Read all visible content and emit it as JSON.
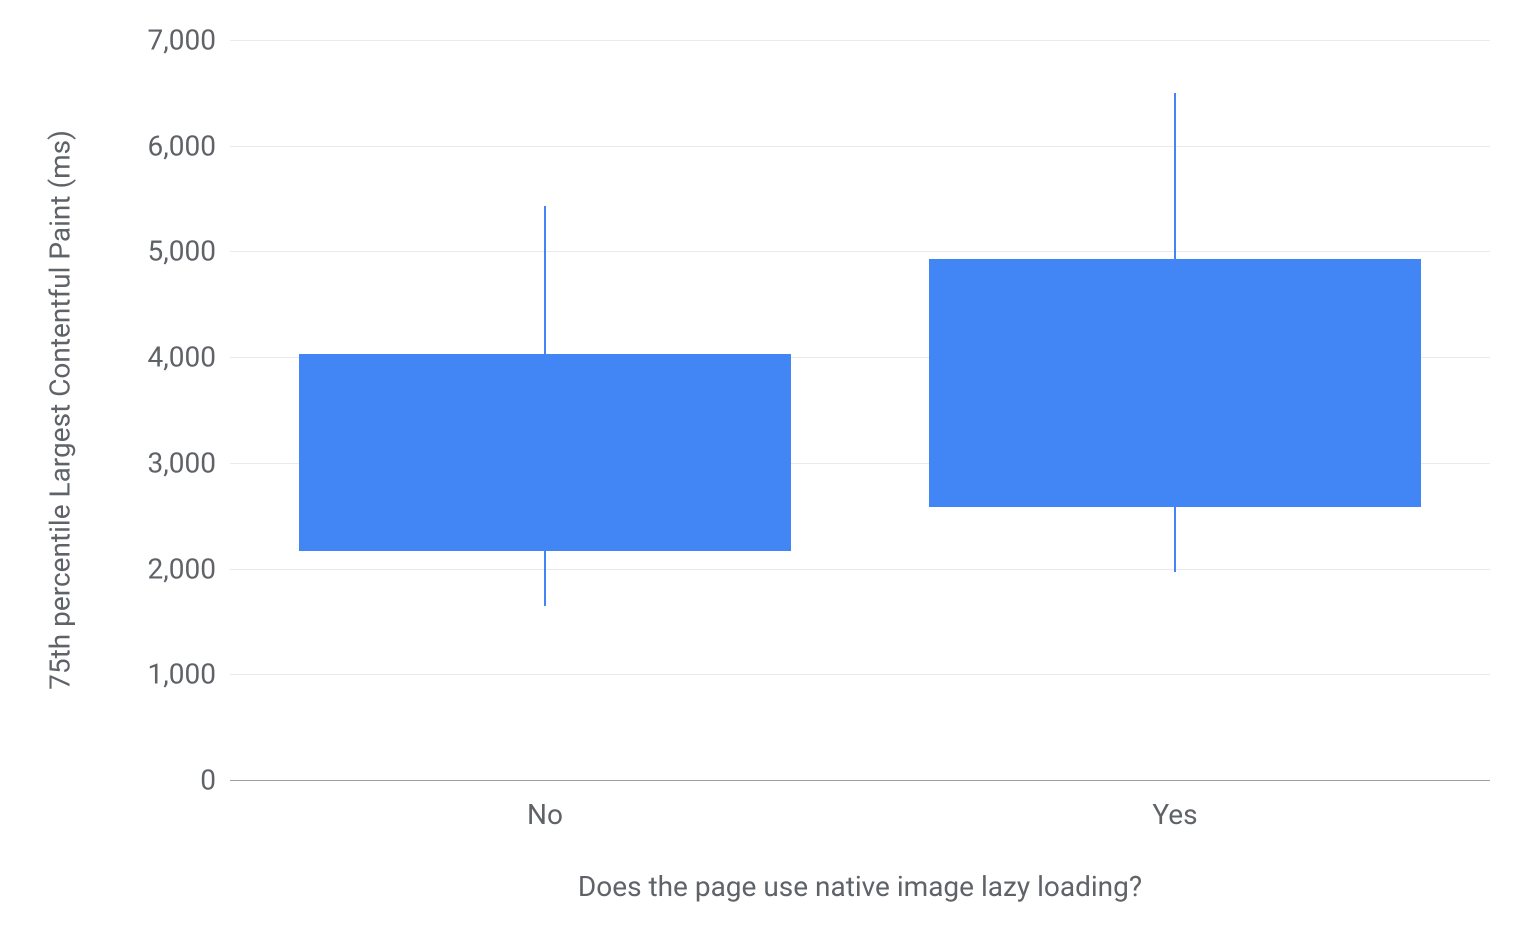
{
  "chart_data": {
    "type": "boxplot",
    "ylabel": "75th percentile Largest Contentful Paint (ms)",
    "xlabel": "Does the page use native image lazy loading?",
    "categories": [
      "No",
      "Yes"
    ],
    "y_ticks": [
      0,
      1000,
      2000,
      3000,
      4000,
      5000,
      6000,
      7000
    ],
    "y_tick_labels": [
      "0",
      "1,000",
      "2,000",
      "3,000",
      "4,000",
      "5,000",
      "6,000",
      "7,000"
    ],
    "ylim": [
      0,
      7000
    ],
    "series": [
      {
        "name": "No",
        "lower_whisker": 1650,
        "q1": 2170,
        "q3": 4030,
        "upper_whisker": 5430
      },
      {
        "name": "Yes",
        "lower_whisker": 1970,
        "q1": 2580,
        "q3": 4930,
        "upper_whisker": 6500
      }
    ],
    "box_width_fraction": 0.78,
    "box_color": "#4285F4"
  }
}
